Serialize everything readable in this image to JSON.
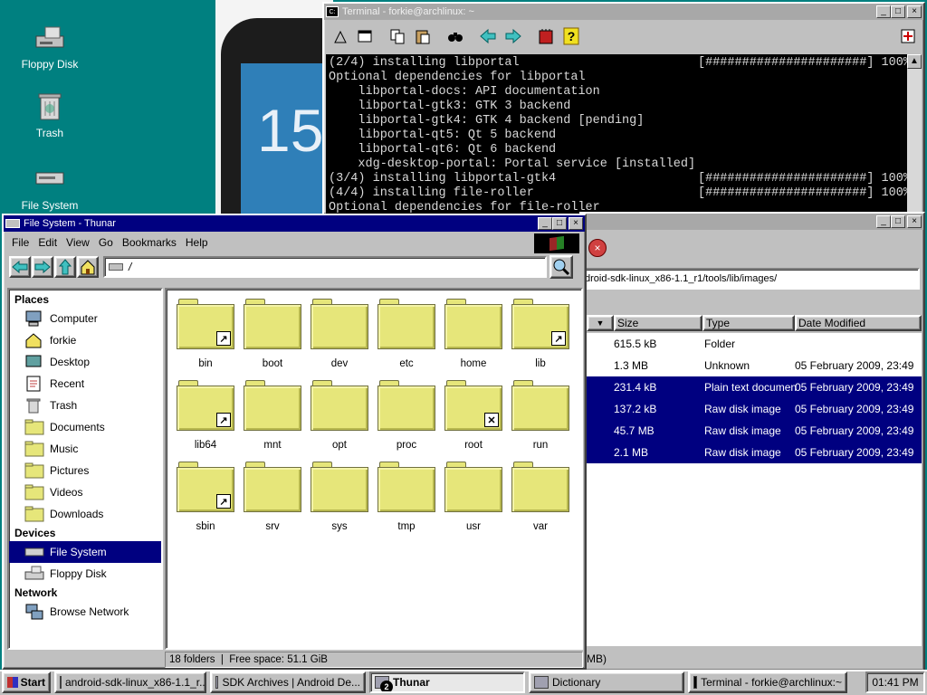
{
  "desktop": {
    "icons": [
      {
        "label": "Floppy Disk",
        "icon": "floppy-disk-icon"
      },
      {
        "label": "Trash",
        "icon": "trash-icon"
      },
      {
        "label": "File System",
        "icon": "drive-icon"
      }
    ],
    "wallpaper_text": "15"
  },
  "terminal": {
    "title": "Terminal - forkie@archlinux: ~",
    "lines": [
      {
        "text": "(2/4) installing libportal",
        "progress": "[######################] 100%"
      },
      {
        "text": "Optional dependencies for libportal",
        "progress": ""
      },
      {
        "text": "    libportal-docs: API documentation",
        "progress": ""
      },
      {
        "text": "    libportal-gtk3: GTK 3 backend",
        "progress": ""
      },
      {
        "text": "    libportal-gtk4: GTK 4 backend [pending]",
        "progress": ""
      },
      {
        "text": "    libportal-qt5: Qt 5 backend",
        "progress": ""
      },
      {
        "text": "    libportal-qt6: Qt 6 backend",
        "progress": ""
      },
      {
        "text": "    xdg-desktop-portal: Portal service [installed]",
        "progress": ""
      },
      {
        "text": "(3/4) installing libportal-gtk4",
        "progress": "[######################] 100%"
      },
      {
        "text": "(4/4) installing file-roller",
        "progress": "[######################] 100%"
      },
      {
        "text": "Optional dependencies for file-roller",
        "progress": ""
      }
    ]
  },
  "archive_window": {
    "path": "droid-sdk-linux_x86-1.1_r1/tools/lib/images/",
    "columns": [
      "Size",
      "Type",
      "Date Modified"
    ],
    "rows": [
      {
        "size": "615.5 kB",
        "type": "Folder",
        "date": "",
        "selected": false
      },
      {
        "size": "1.3 MB",
        "type": "Unknown",
        "date": "05 February 2009, 23:49",
        "selected": false
      },
      {
        "size": "231.4 kB",
        "type": "Plain text document",
        "date": "05 February 2009, 23:49",
        "selected": true
      },
      {
        "size": "137.2 kB",
        "type": "Raw disk image",
        "date": "05 February 2009, 23:49",
        "selected": true
      },
      {
        "size": "45.7 MB",
        "type": "Raw disk image",
        "date": "05 February 2009, 23:49",
        "selected": true
      },
      {
        "size": "2.1 MB",
        "type": "Raw disk image",
        "date": "05 February 2009, 23:49",
        "selected": true
      }
    ],
    "status_tail": "MB)"
  },
  "thunar": {
    "title": "File System - Thunar",
    "menu": [
      "File",
      "Edit",
      "View",
      "Go",
      "Bookmarks",
      "Help"
    ],
    "location": "/",
    "sidebar": {
      "places_heading": "Places",
      "places": [
        "Computer",
        "forkie",
        "Desktop",
        "Recent",
        "Trash",
        "Documents",
        "Music",
        "Pictures",
        "Videos",
        "Downloads"
      ],
      "devices_heading": "Devices",
      "devices": [
        "File System",
        "Floppy Disk"
      ],
      "network_heading": "Network",
      "network": [
        "Browse Network"
      ]
    },
    "folders": [
      {
        "name": "bin",
        "badge": "link"
      },
      {
        "name": "boot",
        "badge": ""
      },
      {
        "name": "dev",
        "badge": ""
      },
      {
        "name": "etc",
        "badge": ""
      },
      {
        "name": "home",
        "badge": ""
      },
      {
        "name": "lib",
        "badge": "link"
      },
      {
        "name": "lib64",
        "badge": "link"
      },
      {
        "name": "mnt",
        "badge": ""
      },
      {
        "name": "opt",
        "badge": ""
      },
      {
        "name": "proc",
        "badge": ""
      },
      {
        "name": "root",
        "badge": "locked"
      },
      {
        "name": "run",
        "badge": ""
      },
      {
        "name": "sbin",
        "badge": "link"
      },
      {
        "name": "srv",
        "badge": ""
      },
      {
        "name": "sys",
        "badge": ""
      },
      {
        "name": "tmp",
        "badge": ""
      },
      {
        "name": "usr",
        "badge": ""
      },
      {
        "name": "var",
        "badge": ""
      }
    ],
    "status": "18 folders  |  Free space: 51.1 GiB"
  },
  "taskbar": {
    "start": "Start",
    "tasks": [
      {
        "label": "android-sdk-linux_x86-1.1_r...",
        "active": false
      },
      {
        "label": "SDK Archives | Android De...",
        "active": false
      },
      {
        "label": "Thunar",
        "active": true,
        "count": "2"
      },
      {
        "label": "Dictionary",
        "active": false
      },
      {
        "label": "Terminal - forkie@archlinux:~",
        "active": false
      }
    ],
    "clock": "01:41 PM"
  },
  "colors": {
    "desktop": "#008080",
    "titlebar_active": "#000080",
    "selection": "#000080",
    "folder": "#e6e67a"
  }
}
